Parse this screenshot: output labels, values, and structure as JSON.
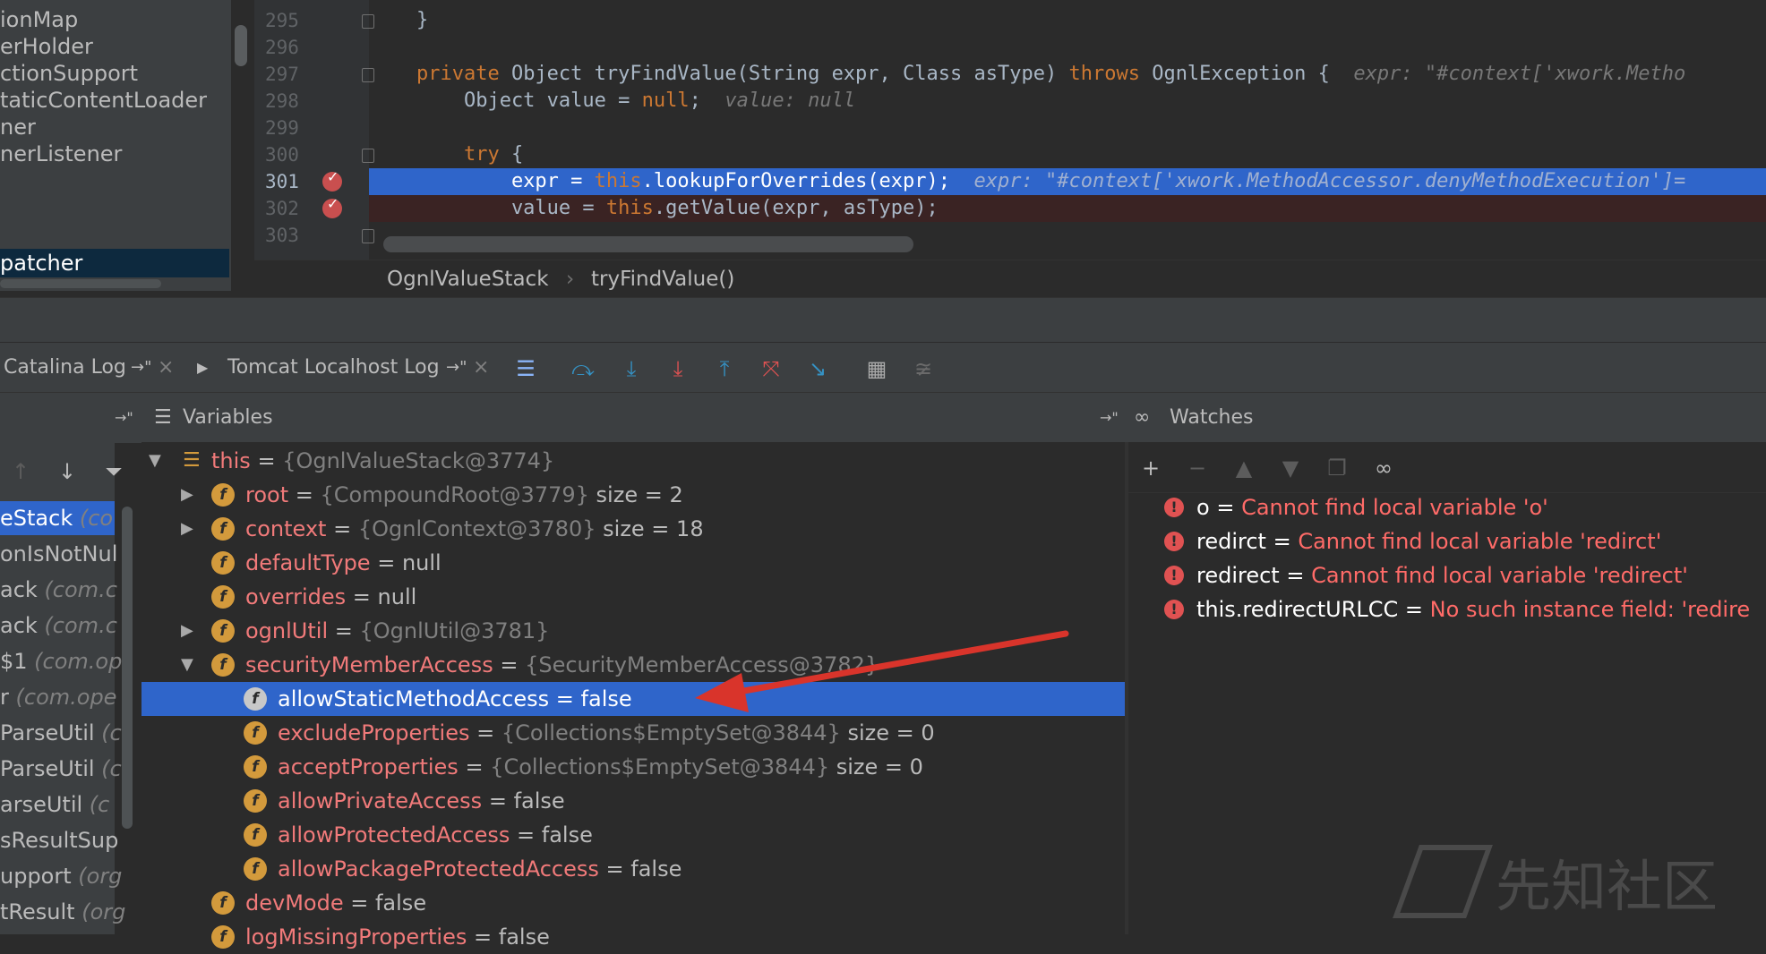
{
  "project_tree": {
    "items": [
      "ionMap",
      "erHolder",
      "ctionSupport",
      "taticContentLoader",
      "ner",
      "nerListener",
      "patcher"
    ],
    "selected_index": 6
  },
  "editor": {
    "lines": [
      {
        "num": "295",
        "code": "    }"
      },
      {
        "num": "296",
        "code": ""
      },
      {
        "num": "297",
        "pre": "    ",
        "kw": "private",
        "code": " Object tryFindValue(String expr, Class asType) ",
        "kw2": "throws",
        "code2": " OgnlException {  ",
        "hint": "expr: \"#context['xwork.Metho"
      },
      {
        "num": "298",
        "code": "        Object value = ",
        "kw": "null",
        "code2": ";  ",
        "hint": "value: null"
      },
      {
        "num": "299",
        "code": ""
      },
      {
        "num": "300",
        "pre": "        ",
        "kw": "try",
        "code": " {"
      },
      {
        "num": "301",
        "code": "            expr = ",
        "kw": "this",
        "code2": ".lookupForOverrides(expr);  ",
        "hint": "expr: \"#context['xwork.MethodAccessor.denyMethodExecution']="
      },
      {
        "num": "302",
        "code": "            value = ",
        "kw": "this",
        "code2": ".getValue(expr, asType);"
      },
      {
        "num": "303",
        "code": ""
      }
    ]
  },
  "breadcrumb": {
    "class_name": "OgnlValueStack",
    "separator": "›",
    "method": "tryFindValue()"
  },
  "debug_tabs": [
    {
      "label": "Catalina Log",
      "pin": "→\"",
      "close": "×"
    },
    {
      "label": "Tomcat Localhost Log",
      "pin": "→\"",
      "close": "×"
    }
  ],
  "panels": {
    "variables_title": "Variables",
    "watches_title": "Watches"
  },
  "frames": [
    {
      "name": "eStack",
      "pkg": " (co",
      "selected": true
    },
    {
      "name": "onIsNotNul",
      "pkg": ""
    },
    {
      "name": "ack",
      "pkg": " (com.c"
    },
    {
      "name": "ack",
      "pkg": " (com.c"
    },
    {
      "name": "$1",
      "pkg": " (com.op"
    },
    {
      "name": "r",
      "pkg": " (com.ope"
    },
    {
      "name": "ParseUtil",
      "pkg": " (c"
    },
    {
      "name": "ParseUtil",
      "pkg": " (c"
    },
    {
      "name": "arseUtil",
      "pkg": " (c"
    },
    {
      "name": "sResultSup",
      "pkg": ""
    },
    {
      "name": "upport",
      "pkg": " (org"
    },
    {
      "name": "tResult",
      "pkg": " (org"
    }
  ],
  "variables": [
    {
      "name": "this",
      "value": "{OgnlValueStack@3774}",
      "extra": ""
    },
    {
      "name": "root",
      "value": "{CompoundRoot@3779}",
      "extra": "size = 2"
    },
    {
      "name": "context",
      "value": "{OgnlContext@3780}",
      "extra": "size = 18"
    },
    {
      "name": "defaultType",
      "value": "null",
      "extra": ""
    },
    {
      "name": "overrides",
      "value": "null",
      "extra": ""
    },
    {
      "name": "ognlUtil",
      "value": "{OgnlUtil@3781}",
      "extra": ""
    },
    {
      "name": "securityMemberAccess",
      "value": "{SecurityMemberAccess@3782}",
      "extra": ""
    },
    {
      "name": "allowStaticMethodAccess",
      "value": "false",
      "extra": ""
    },
    {
      "name": "excludeProperties",
      "value": "{Collections$EmptySet@3844}",
      "extra": "size = 0"
    },
    {
      "name": "acceptProperties",
      "value": "{Collections$EmptySet@3844}",
      "extra": "size = 0"
    },
    {
      "name": "allowPrivateAccess",
      "value": "false",
      "extra": ""
    },
    {
      "name": "allowProtectedAccess",
      "value": "false",
      "extra": ""
    },
    {
      "name": "allowPackageProtectedAccess",
      "value": "false",
      "extra": ""
    },
    {
      "name": "devMode",
      "value": "false",
      "extra": ""
    },
    {
      "name": "logMissingProperties",
      "value": "false",
      "extra": ""
    }
  ],
  "watches": [
    {
      "name": "o",
      "message": "Cannot find local variable 'o'"
    },
    {
      "name": "redirct",
      "message": "Cannot find local variable 'redirct'"
    },
    {
      "name": "redirect",
      "message": "Cannot find local variable 'redirect'"
    },
    {
      "name": "this.redirectURLCC",
      "message": "No such instance field: 'redire"
    }
  ],
  "watermark": "先知社区",
  "icons": {
    "equals": "=",
    "field_badge": "f",
    "expanded": "▼",
    "collapsed": "▶",
    "error_badge": "!"
  },
  "colors": {
    "selection": "#2f65ca",
    "breakpoint": "#c94f4f",
    "error_text": "#ff6b68",
    "annotation_arrow": "#d9342b"
  }
}
